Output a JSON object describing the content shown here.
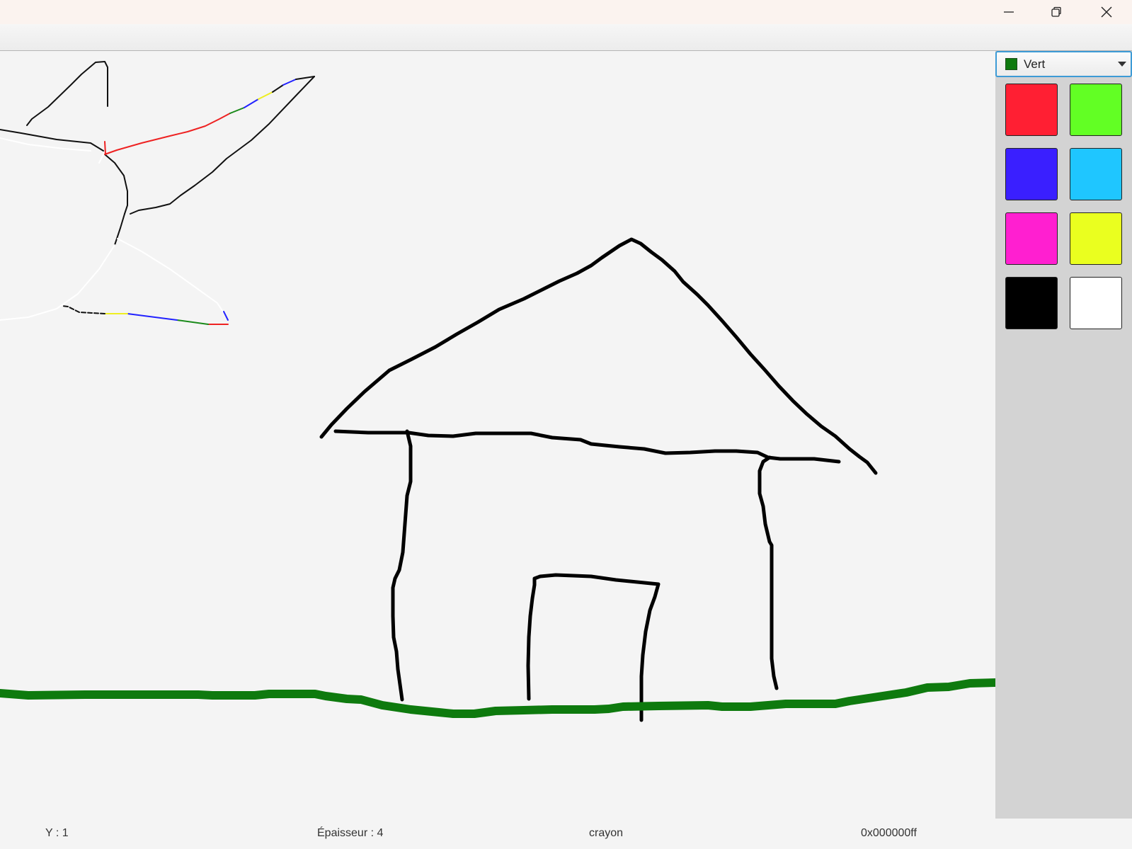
{
  "window": {
    "minimize_icon": "minimize-icon",
    "restore_icon": "restore-icon",
    "close_icon": "close-icon"
  },
  "color_select": {
    "selected_label": "Vert",
    "selected_color": "#0f7a0f"
  },
  "palette": {
    "colors": [
      {
        "name": "red",
        "hex": "#ff1f33"
      },
      {
        "name": "green",
        "hex": "#62ff24"
      },
      {
        "name": "blue",
        "hex": "#3a1fff"
      },
      {
        "name": "cyan",
        "hex": "#1fc6ff"
      },
      {
        "name": "magenta",
        "hex": "#ff1fd0"
      },
      {
        "name": "yellow",
        "hex": "#eaff1f"
      },
      {
        "name": "black",
        "hex": "#000000"
      },
      {
        "name": "white",
        "hex": "#ffffff"
      }
    ]
  },
  "status": {
    "y_coord": "Y : 1",
    "thickness": "Épaisseur : 4",
    "tool": "crayon",
    "color_hex": "0x000000ff"
  }
}
